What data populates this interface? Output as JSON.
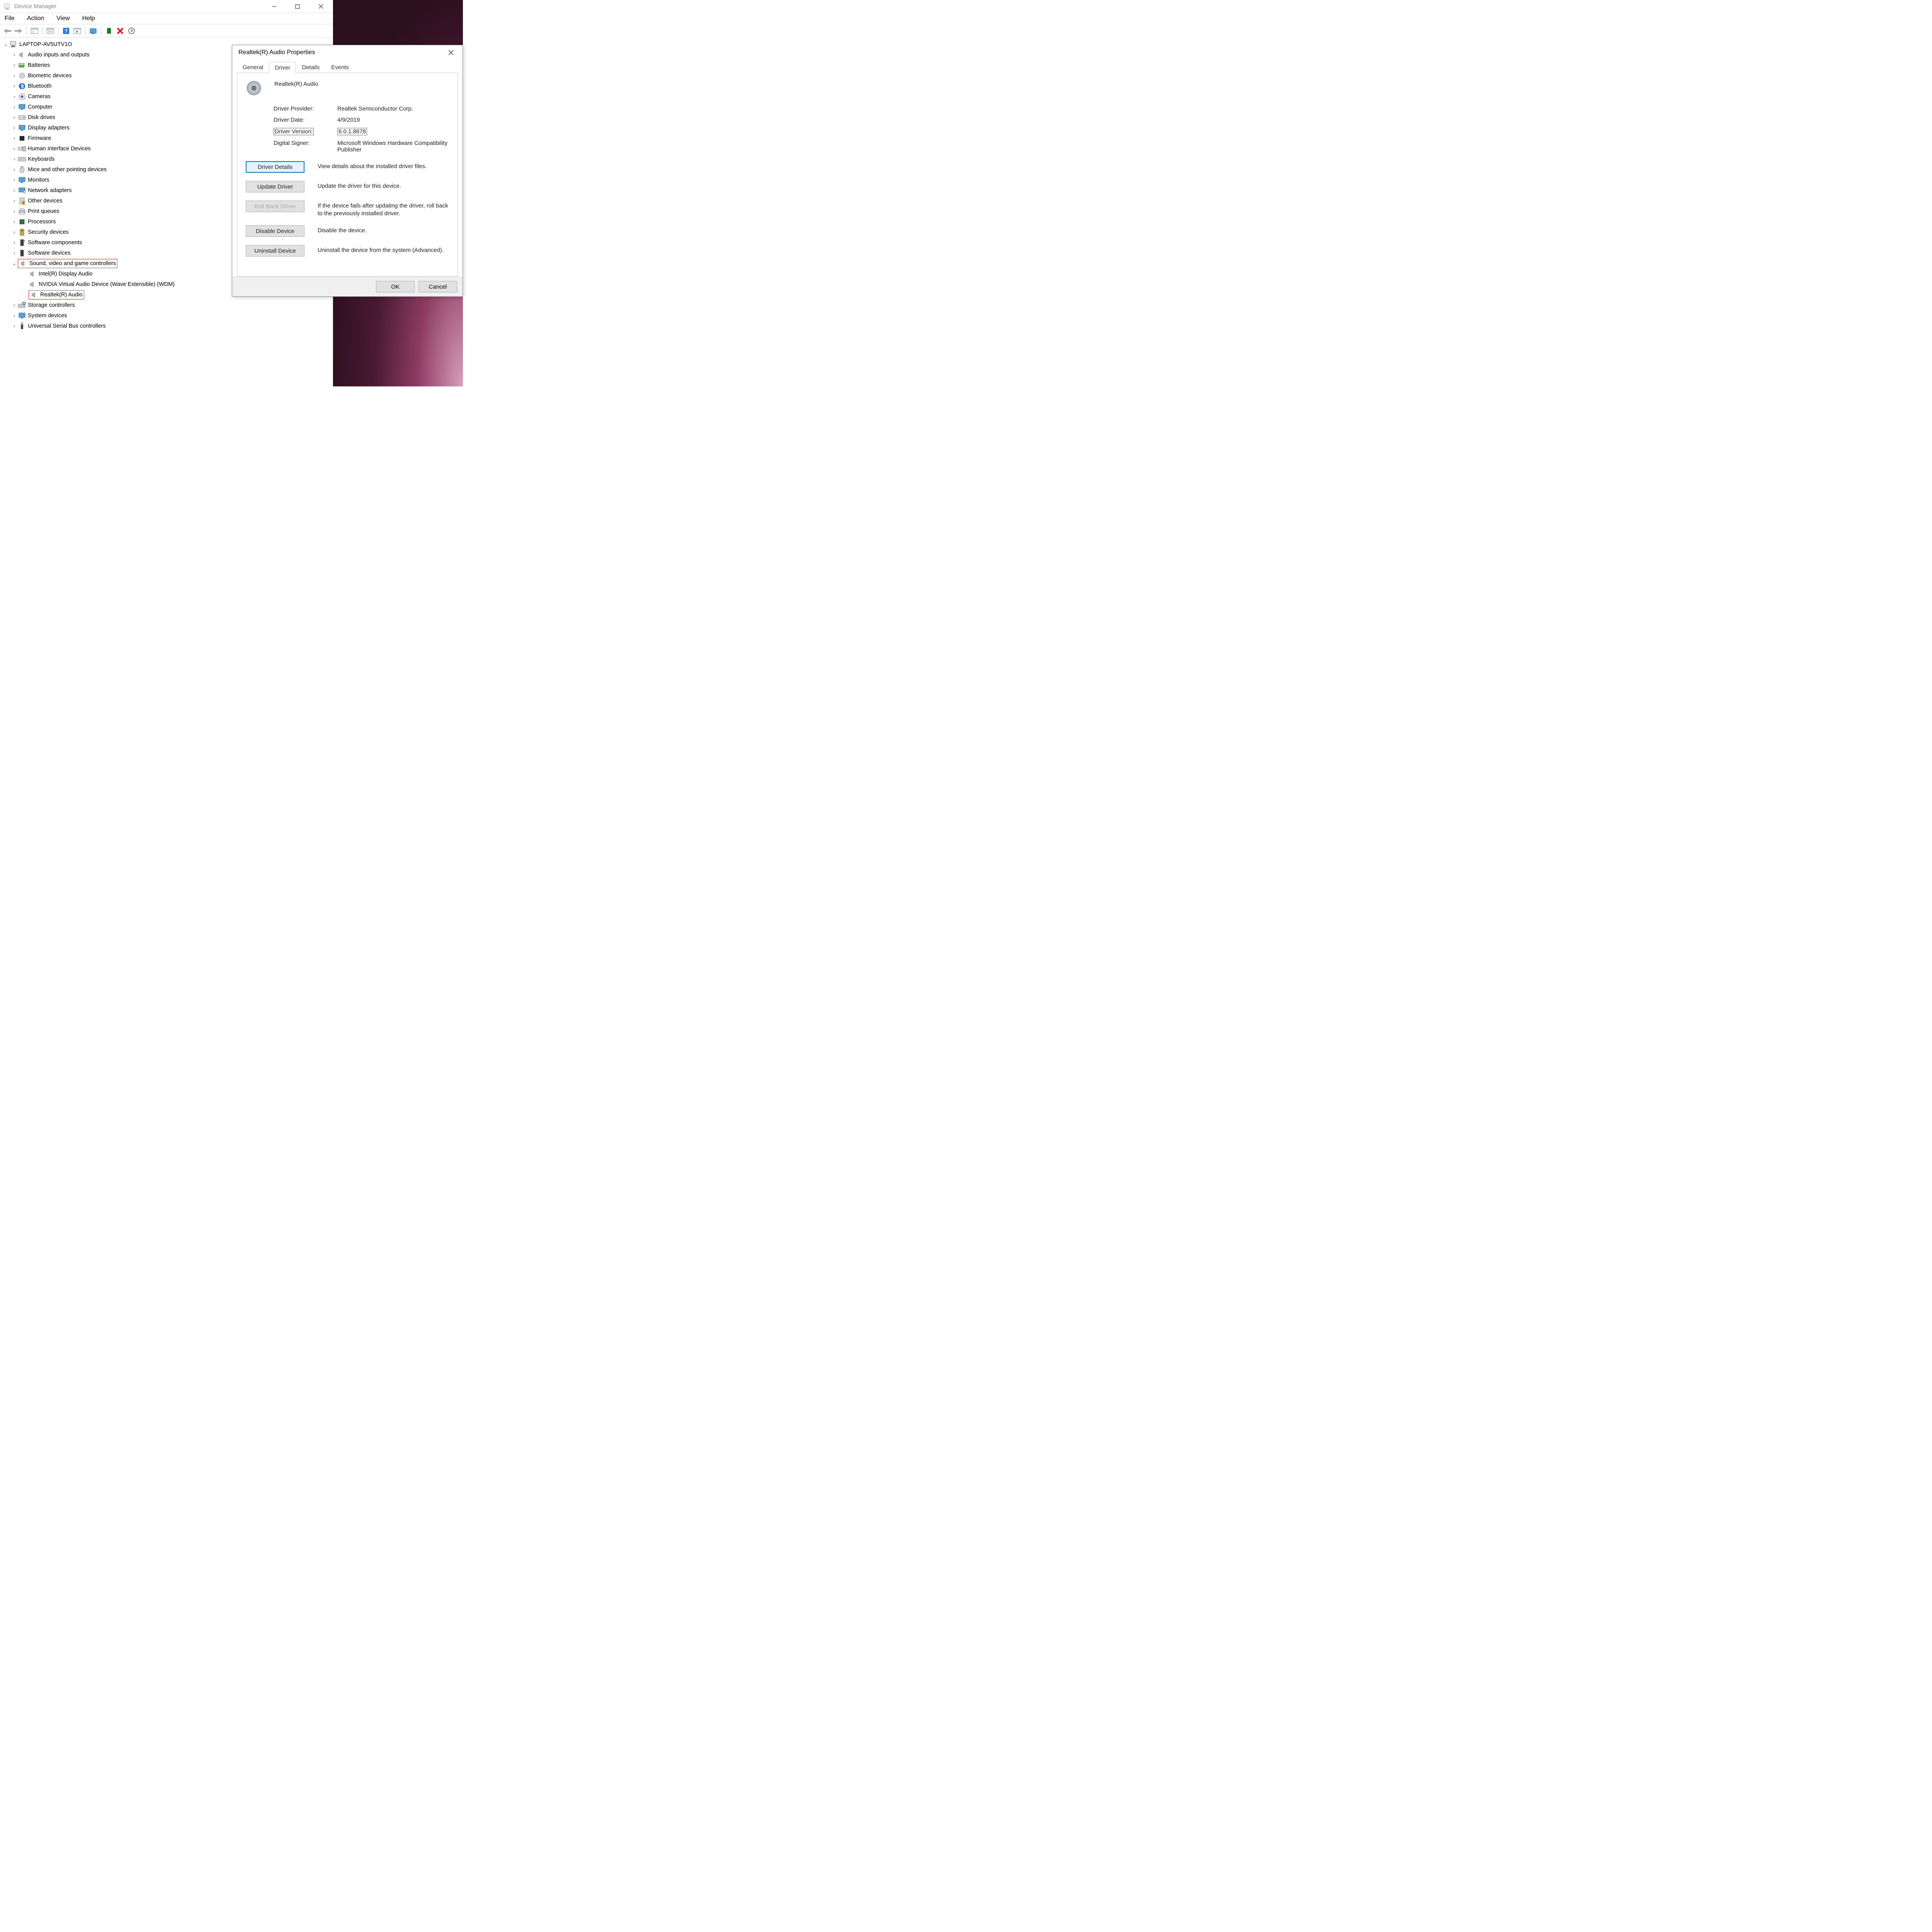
{
  "devmgr": {
    "title": "Device Manager",
    "menu": {
      "file": "File",
      "action": "Action",
      "view": "View",
      "help": "Help"
    },
    "root": "LAPTOP-AV5UTV1O",
    "categories": [
      "Audio inputs and outputs",
      "Batteries",
      "Biometric devices",
      "Bluetooth",
      "Cameras",
      "Computer",
      "Disk drives",
      "Display adapters",
      "Firmware",
      "Human Interface Devices",
      "Keyboards",
      "Mice and other pointing devices",
      "Monitors",
      "Network adapters",
      "Other devices",
      "Print queues",
      "Processors",
      "Security devices",
      "Software components",
      "Software devices"
    ],
    "sound_cat": "Sound, video and game controllers",
    "sound_children": [
      "Intel(R) Display Audio",
      "NVIDIA Virtual Audio Device (Wave Extensible) (WDM)",
      "Realtek(R) Audio"
    ],
    "after": [
      "Storage controllers",
      "System devices",
      "Universal Serial Bus controllers"
    ]
  },
  "dialog": {
    "title": "Realtek(R) Audio Properties",
    "tabs": {
      "general": "General",
      "driver": "Driver",
      "details": "Details",
      "events": "Events"
    },
    "device_name": "Realtek(R) Audio",
    "provider_k": "Driver Provider:",
    "provider_v": "Realtek Semiconductor Corp.",
    "date_k": "Driver Date:",
    "date_v": "4/9/2019",
    "version_k": "Driver Version:",
    "version_v": "6.0.1.8678",
    "signer_k": "Digital Signer:",
    "signer_v": "Microsoft Windows Hardware Compatibility Publisher",
    "b_details": "Driver Details",
    "d_details": "View details about the installed driver files.",
    "b_update": "Update Driver",
    "d_update": "Update the driver for this device.",
    "b_rollback": "Roll Back Driver",
    "d_rollback": "If the device fails after updating the driver, roll back to the previously installed driver.",
    "b_disable": "Disable Device",
    "d_disable": "Disable the device.",
    "b_uninstall": "Uninstall Device",
    "d_uninstall": "Uninstall the device from the system (Advanced).",
    "ok": "OK",
    "cancel": "Cancel"
  }
}
